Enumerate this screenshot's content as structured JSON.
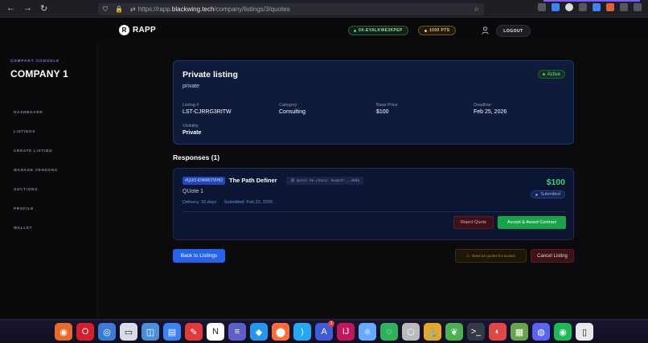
{
  "browser": {
    "url_prefix": "https://rapp.",
    "url_host": "blackwing.tech",
    "url_path": "/company/listings/3/quotes"
  },
  "header": {
    "logo_mark": "R",
    "logo_text": "RAPP",
    "wallet": "0X-EYALKWE3KPEP",
    "points": "1000 PTS",
    "logout": "LOGOUT"
  },
  "sidebar": {
    "label": "COMPANY CONSOLE",
    "title": "COMPANY 1",
    "items": [
      {
        "label": "DASHBOARD"
      },
      {
        "label": "LISTINGS"
      },
      {
        "label": "CREATE LISTING"
      },
      {
        "label": "MANAGE VENDORS"
      },
      {
        "label": "AUCTIONS"
      },
      {
        "label": "PROFILE"
      },
      {
        "label": "WALLET"
      }
    ]
  },
  "listing": {
    "title": "Private listing",
    "subtitle": "private",
    "status": "Active",
    "fields": {
      "number_label": "Listing #",
      "number_value": "LST-CJRRG3RITW",
      "category_label": "Category",
      "category_value": "Consulting",
      "price_label": "Base Price",
      "price_value": "$100",
      "deadline_label": "Deadline",
      "deadline_value": "Feb 25, 2026",
      "visibility_label": "Visibility",
      "visibility_value": "Private"
    }
  },
  "responses": {
    "heading": "Responses (1)",
    "items": [
      {
        "quote_id": "#QUO-IDWR67VIHO",
        "vendor": "The Path Definer",
        "hash": "Quote On-chain: 0x8247...45b8",
        "title": "QUote 1",
        "delivery": "Delivery: 30 days",
        "submitted": "Submitted: Feb 22, 2026",
        "price": "$100",
        "status": "Submitted",
        "reject": "Reject Quote",
        "accept": "Accept & Award Contract"
      }
    ]
  },
  "footer_actions": {
    "back": "Back to Listings",
    "note": "Need ≥2 quotes for auction",
    "cancel": "Cancel Listing"
  },
  "dock": {
    "badge_count": "3",
    "apps": [
      "firefox-icon",
      "opera-icon",
      "chrome-icon",
      "files-icon",
      "store-icon",
      "docs-icon",
      "pdf-icon",
      "notion-icon",
      "editor-icon",
      "docker-icon",
      "postman-icon",
      "vscode-icon",
      "dev-icon",
      "intellij-icon",
      "atom-icon",
      "sync-icon",
      "box-icon",
      "pirate-icon",
      "mongodb-icon",
      "terminal-icon",
      "toggle-icon",
      "photos-icon",
      "discord-icon",
      "spotify-icon",
      "trash-icon"
    ]
  }
}
